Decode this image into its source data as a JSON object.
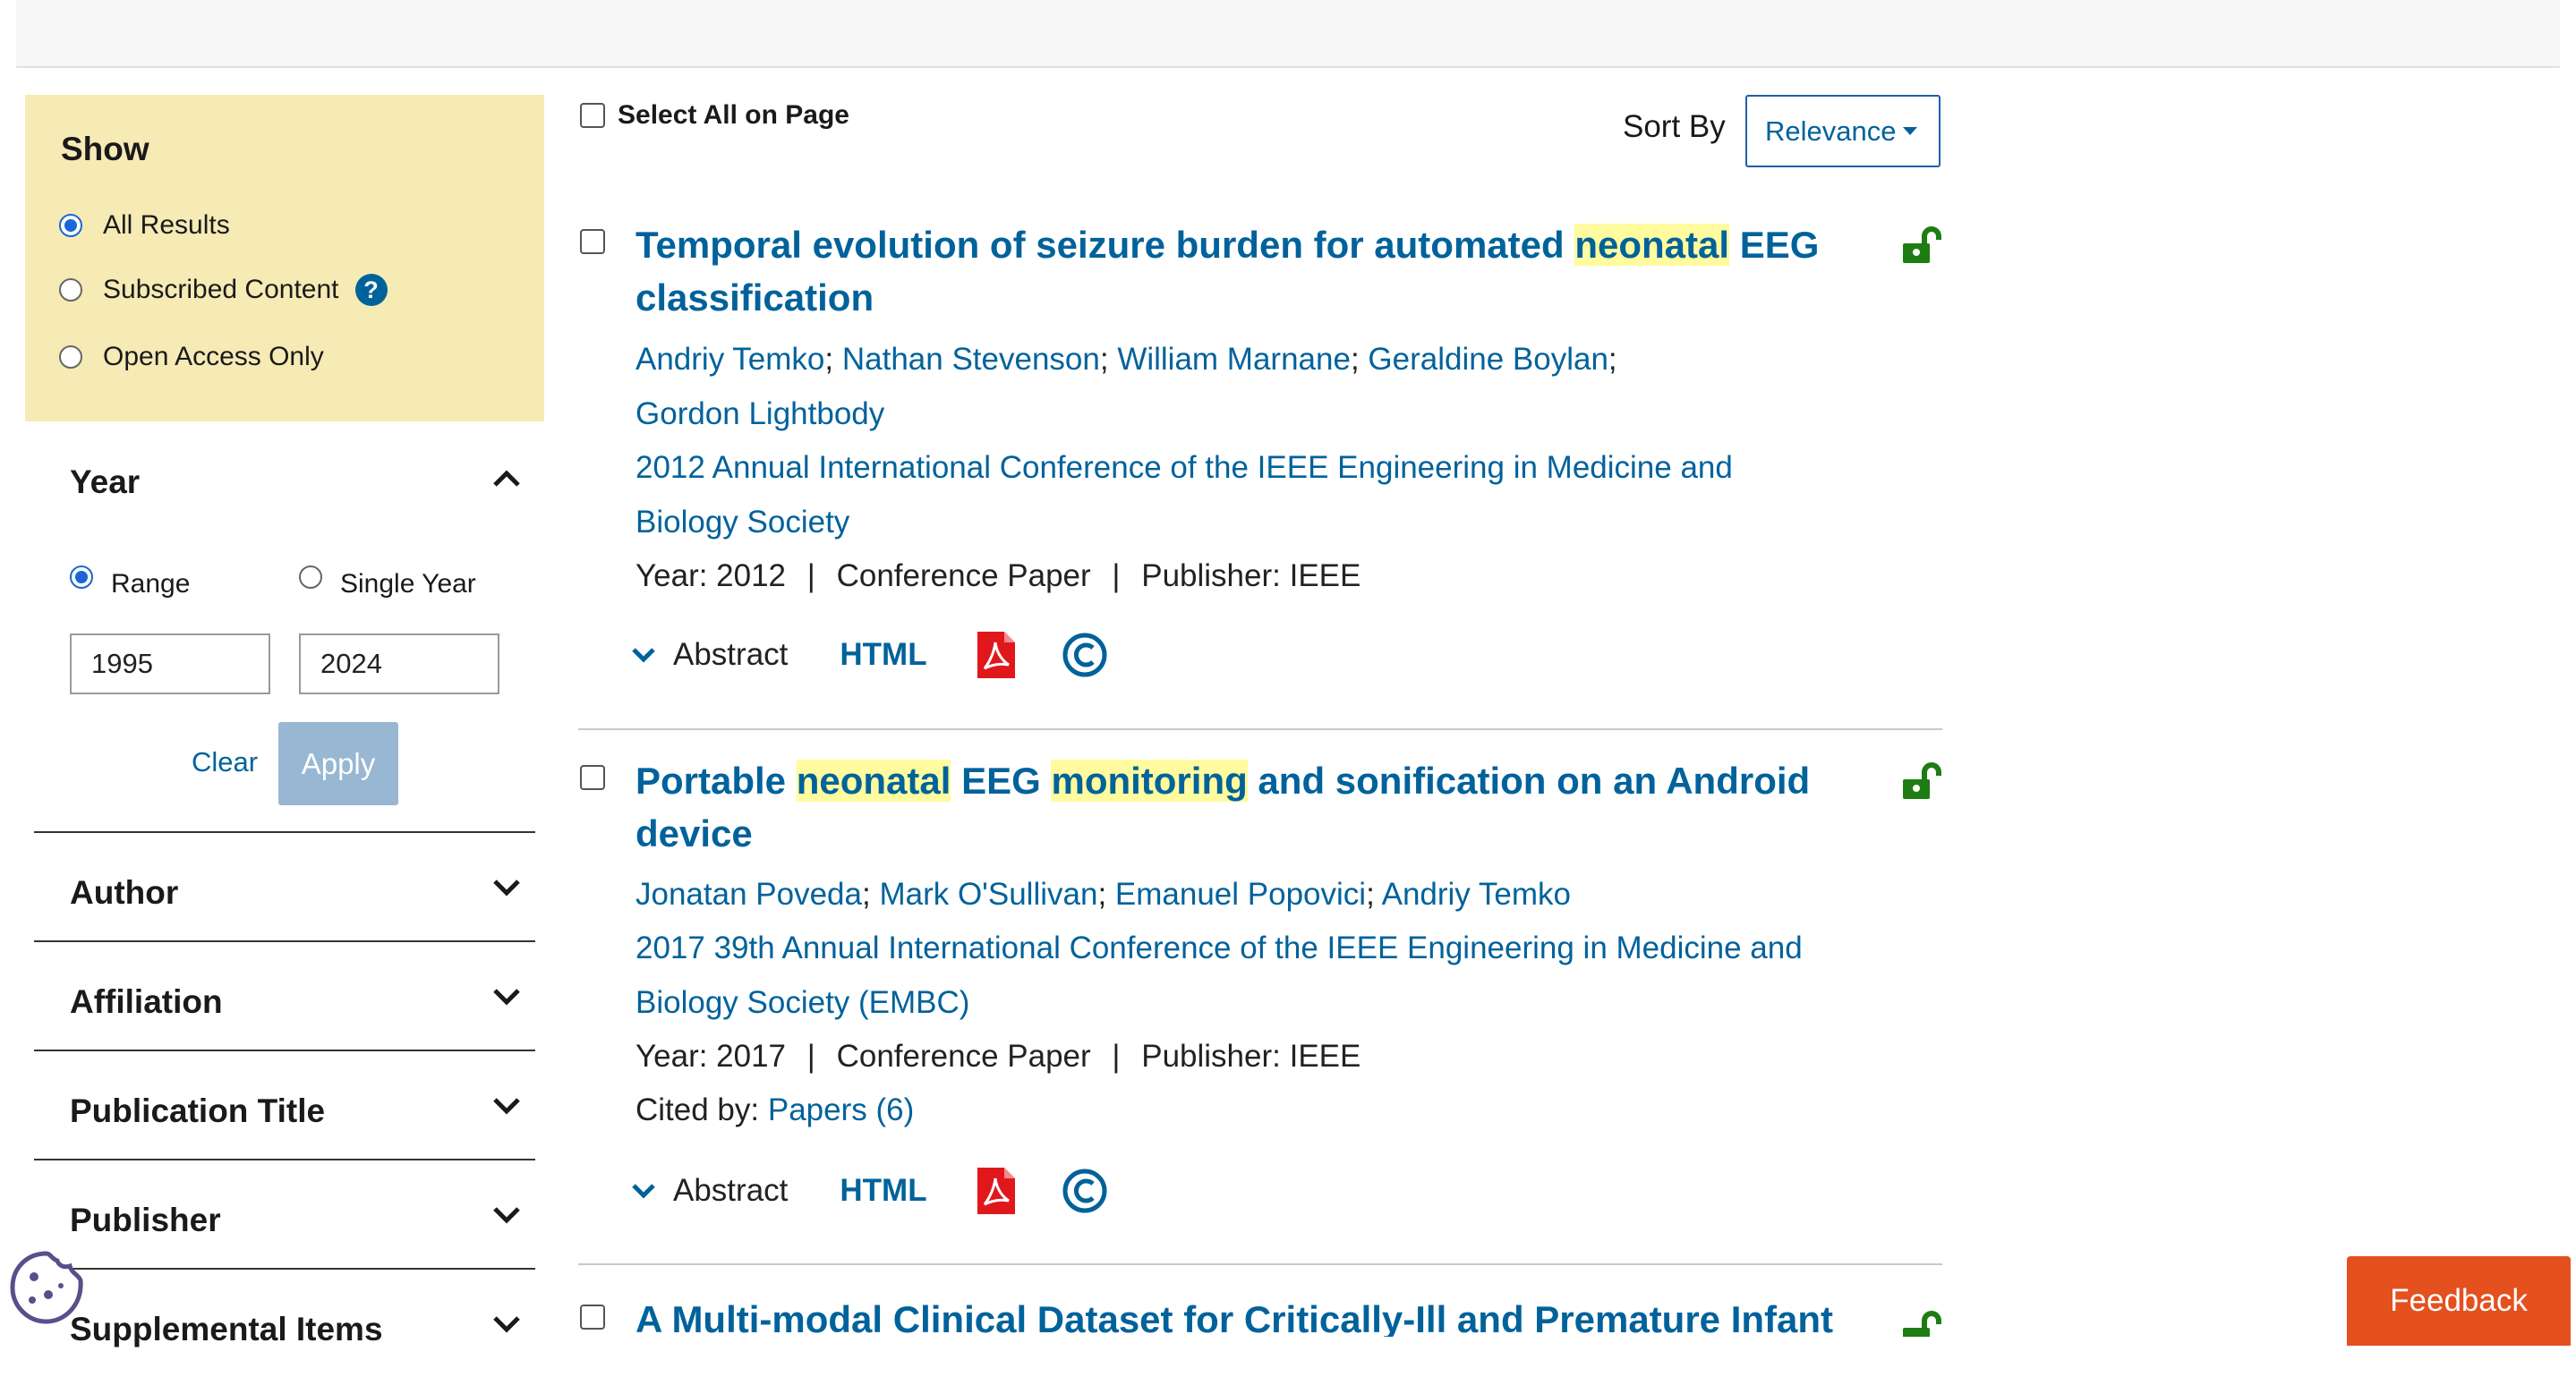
{
  "sidebar": {
    "show": {
      "title": "Show",
      "options": [
        {
          "label": "All Results",
          "selected": true
        },
        {
          "label": "Subscribed Content",
          "selected": false
        },
        {
          "label": "Open Access Only",
          "selected": false
        }
      ],
      "help_icon": "?"
    },
    "year": {
      "title": "Year",
      "range_label": "Range",
      "single_label": "Single Year",
      "range_selected": true,
      "from": "1995",
      "to": "2024",
      "clear_label": "Clear",
      "apply_label": "Apply"
    },
    "facets": [
      "Author",
      "Affiliation",
      "Publication Title",
      "Publisher",
      "Supplemental Items"
    ]
  },
  "toolbar": {
    "select_all_label": "Select All on Page",
    "sort_label": "Sort By",
    "sort_value": "Relevance"
  },
  "results": [
    {
      "title_parts": [
        {
          "text": "Temporal evolution of seizure burden for automated ",
          "hl": false
        },
        {
          "text": "neonatal",
          "hl": true
        },
        {
          "text": " EEG classification",
          "hl": false
        }
      ],
      "authors_line1": [
        "Andriy Temko",
        "Nathan Stevenson",
        "William Marnane",
        "Geraldine Boylan"
      ],
      "authors_line2": [
        "Gordon Lightbody"
      ],
      "publication_line1": "2012 Annual International Conference of the IEEE Engineering in Medicine and",
      "publication_line2": "Biology Society",
      "year_text": "Year: 2012",
      "type_text": "Conference Paper",
      "publisher_text": "Publisher:  IEEE",
      "cited_label": "",
      "cited_link": "",
      "abstract_label": "Abstract",
      "html_label": "HTML"
    },
    {
      "title_parts": [
        {
          "text": "Portable ",
          "hl": false
        },
        {
          "text": "neonatal",
          "hl": true
        },
        {
          "text": " EEG ",
          "hl": false
        },
        {
          "text": " monitoring",
          "hl": true
        },
        {
          "text": " and sonification on an Android device",
          "hl": false
        }
      ],
      "authors_line1": [
        "Jonatan Poveda",
        "Mark O'Sullivan",
        "Emanuel Popovici",
        "Andriy Temko"
      ],
      "authors_line2": [],
      "publication_line1": "2017 39th Annual International Conference of the IEEE Engineering in Medicine and",
      "publication_line2": "Biology Society (EMBC)",
      "year_text": "Year: 2017",
      "type_text": "Conference Paper",
      "publisher_text": "Publisher:  IEEE",
      "cited_label": "Cited by: ",
      "cited_link": "Papers (6)",
      "abstract_label": "Abstract",
      "html_label": "HTML"
    },
    {
      "title_parts": [
        {
          "text": "A Multi-modal Clinical Dataset for Critically-Ill and Premature Infant",
          "hl": false
        }
      ]
    }
  ],
  "icons": {
    "lock": "open-lock-icon",
    "pdf": "pdf-icon",
    "copyright": "copyright-icon",
    "cookie": "cookie-icon"
  },
  "colors": {
    "link": "#00629b",
    "highlight": "#fffb9e",
    "show_panel": "#f6eab5",
    "apply_disabled": "#98b7d3",
    "open_access": "#1e7d12",
    "pdf": "#e0181c",
    "feedback": "#e4511e"
  },
  "feedback_label": "Feedback"
}
